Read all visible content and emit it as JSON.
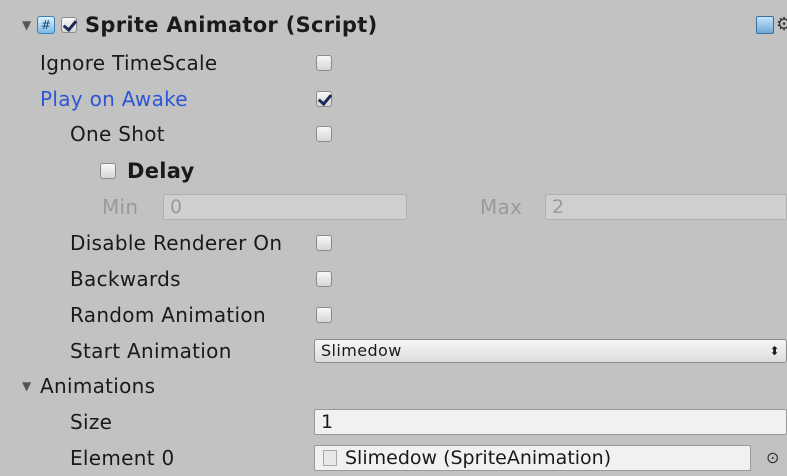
{
  "header": {
    "title": "Sprite Animator (Script)",
    "enabled": true,
    "script_icon": "script-icon",
    "help_icon": "help-book-icon",
    "settings_icon": "gear-icon"
  },
  "properties": {
    "ignore_timescale": {
      "label": "Ignore TimeScale",
      "checked": false
    },
    "play_on_awake": {
      "label": "Play on Awake",
      "checked": true
    },
    "one_shot": {
      "label": "One Shot",
      "checked": false
    },
    "delay": {
      "label": "Delay",
      "checked": false
    },
    "min": {
      "label": "Min",
      "value": "0"
    },
    "max": {
      "label": "Max",
      "value": "2"
    },
    "disable_renderer": {
      "label": "Disable Renderer On",
      "checked": false
    },
    "backwards": {
      "label": "Backwards",
      "checked": false
    },
    "random_animation": {
      "label": "Random Animation",
      "checked": false
    },
    "start_animation": {
      "label": "Start Animation",
      "value": "Slimedow"
    }
  },
  "animations": {
    "label": "Animations",
    "size_label": "Size",
    "size_value": "1",
    "element0_label": "Element 0",
    "element0_value": "Slimedow (SpriteAnimation)"
  },
  "colors": {
    "background": "#c2c2c2",
    "modified_label": "#2d55d8"
  }
}
